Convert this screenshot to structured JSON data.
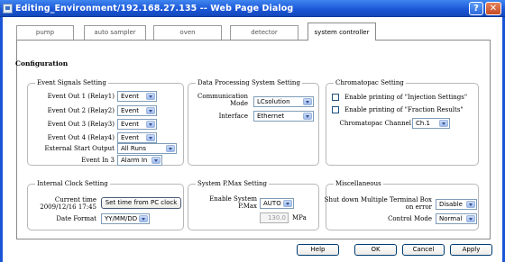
{
  "window": {
    "title": "Editing_Environment/192.168.27.135 -- Web Page Dialog",
    "help_glyph": "?",
    "close_glyph": "✕"
  },
  "tabs": [
    {
      "label": "pump"
    },
    {
      "label": "auto sampler"
    },
    {
      "label": "oven"
    },
    {
      "label": "detector"
    },
    {
      "label": "system controller",
      "active": true
    }
  ],
  "configuration": {
    "title": "Configuration",
    "event_signals": {
      "title": "Event Signals Setting",
      "rows": [
        {
          "label": "Event Out 1 (Relay1)",
          "value": "Event"
        },
        {
          "label": "Event Out 2 (Relay2)",
          "value": "Event"
        },
        {
          "label": "Event Out 3 (Relay3)",
          "value": "Event"
        },
        {
          "label": "Event Out 4 (Relay4)",
          "value": "Event"
        },
        {
          "label": "External Start Output",
          "value": "All Runs"
        },
        {
          "label": "Event In 3",
          "value": "Alarm In"
        }
      ]
    },
    "data_processing": {
      "title": "Data Processing System Setting",
      "communication_label_line1": "Communication",
      "communication_label_line2": "Mode",
      "communication_value": "LCsolution",
      "interface_label": "Interface",
      "interface_value": "Ethernet"
    },
    "chromatopac": {
      "title": "Chromatopac Setting",
      "injection_label": "Enable printing of \"Injection Settings\"",
      "fraction_label": "Enable printing of \"Fraction Results\"",
      "channel_label": "Chromatopac Channel",
      "channel_value": "Ch.1"
    },
    "clock": {
      "title": "Internal Clock Setting",
      "current_time_label": "Current time",
      "current_time_value": "2009/12/16 17:45",
      "set_time_button": "Set time from PC clock",
      "date_format_label": "Date Format",
      "date_format_value": "YY/MM/DD"
    },
    "pmax": {
      "title": "System P.Max Setting",
      "enable_label_line1": "Enable System",
      "enable_label_line2": "P.Max",
      "enable_value": "AUTO",
      "pressure_value": "130.0",
      "pressure_unit": "MPa"
    },
    "misc": {
      "title": "Miscellaneous",
      "shutdown_label_line1": "Shut down Multiple Terminal Box",
      "shutdown_label_line2": "on error",
      "shutdown_value": "Disable",
      "control_mode_label": "Control Mode",
      "control_mode_value": "Normal"
    }
  },
  "footer": {
    "help": "Help",
    "ok": "OK",
    "cancel": "Cancel",
    "apply": "Apply"
  }
}
